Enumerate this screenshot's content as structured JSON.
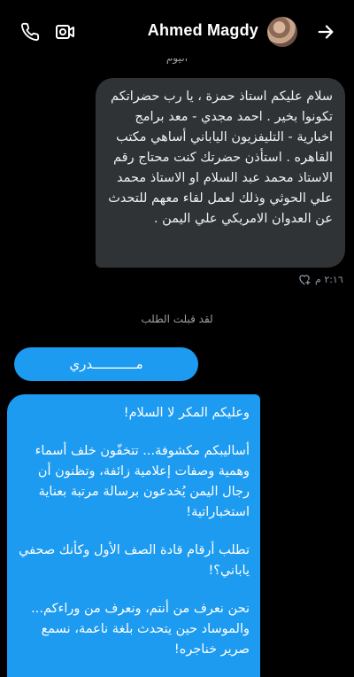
{
  "header": {
    "name": "Ahmed Magdy",
    "icons": {
      "call": "phone-icon",
      "video": "video-icon",
      "back": "arrow-right-icon"
    }
  },
  "conversation": {
    "day_divider": "اليوم",
    "sent_message": {
      "text": "سلام عليكم استاذ حمزة ، يا رب حضراتكم تكونوا بخير . احمد مجدي - معد برامج اخبارية - التليفزيون الياباني أساهي مكتب القاهره . استأذن حضرتك كنت محتاج رقم الاستاذ محمد عبد السلام او الاستاذ محمد علي الحوثي وذلك لعمل لقاء معهم للتحدث عن العدوان الامريكي علي اليمن .",
      "time": "٢:١٦ م"
    },
    "accepted_notice": "لقد قبلت الطلب",
    "received_short": "مـــــــــــدري",
    "received_long": {
      "paragraphs": [
        "وعليكم المكر لا السلام!",
        "أساليبكم مكشوفة... تتخفّون خلف أسماء وهمية وصفات إعلامية زائفة، وتظنون أن رجال اليمن يُخدعون برسالة مرتبة بعناية استخباراتية!",
        "تطلب أرقام قادة الصف الأول وكأنك صحفي ياباني؟!",
        "نحن نعرف من أنتم، ونعرف من وراءكم... والموساد حين يتحدث بلغة ناعمة، نسمع صرير خناجره!"
      ]
    }
  },
  "colors": {
    "received_bubble": "#1d9bf0",
    "sent_bubble": "#2f3336",
    "background": "#000000"
  }
}
